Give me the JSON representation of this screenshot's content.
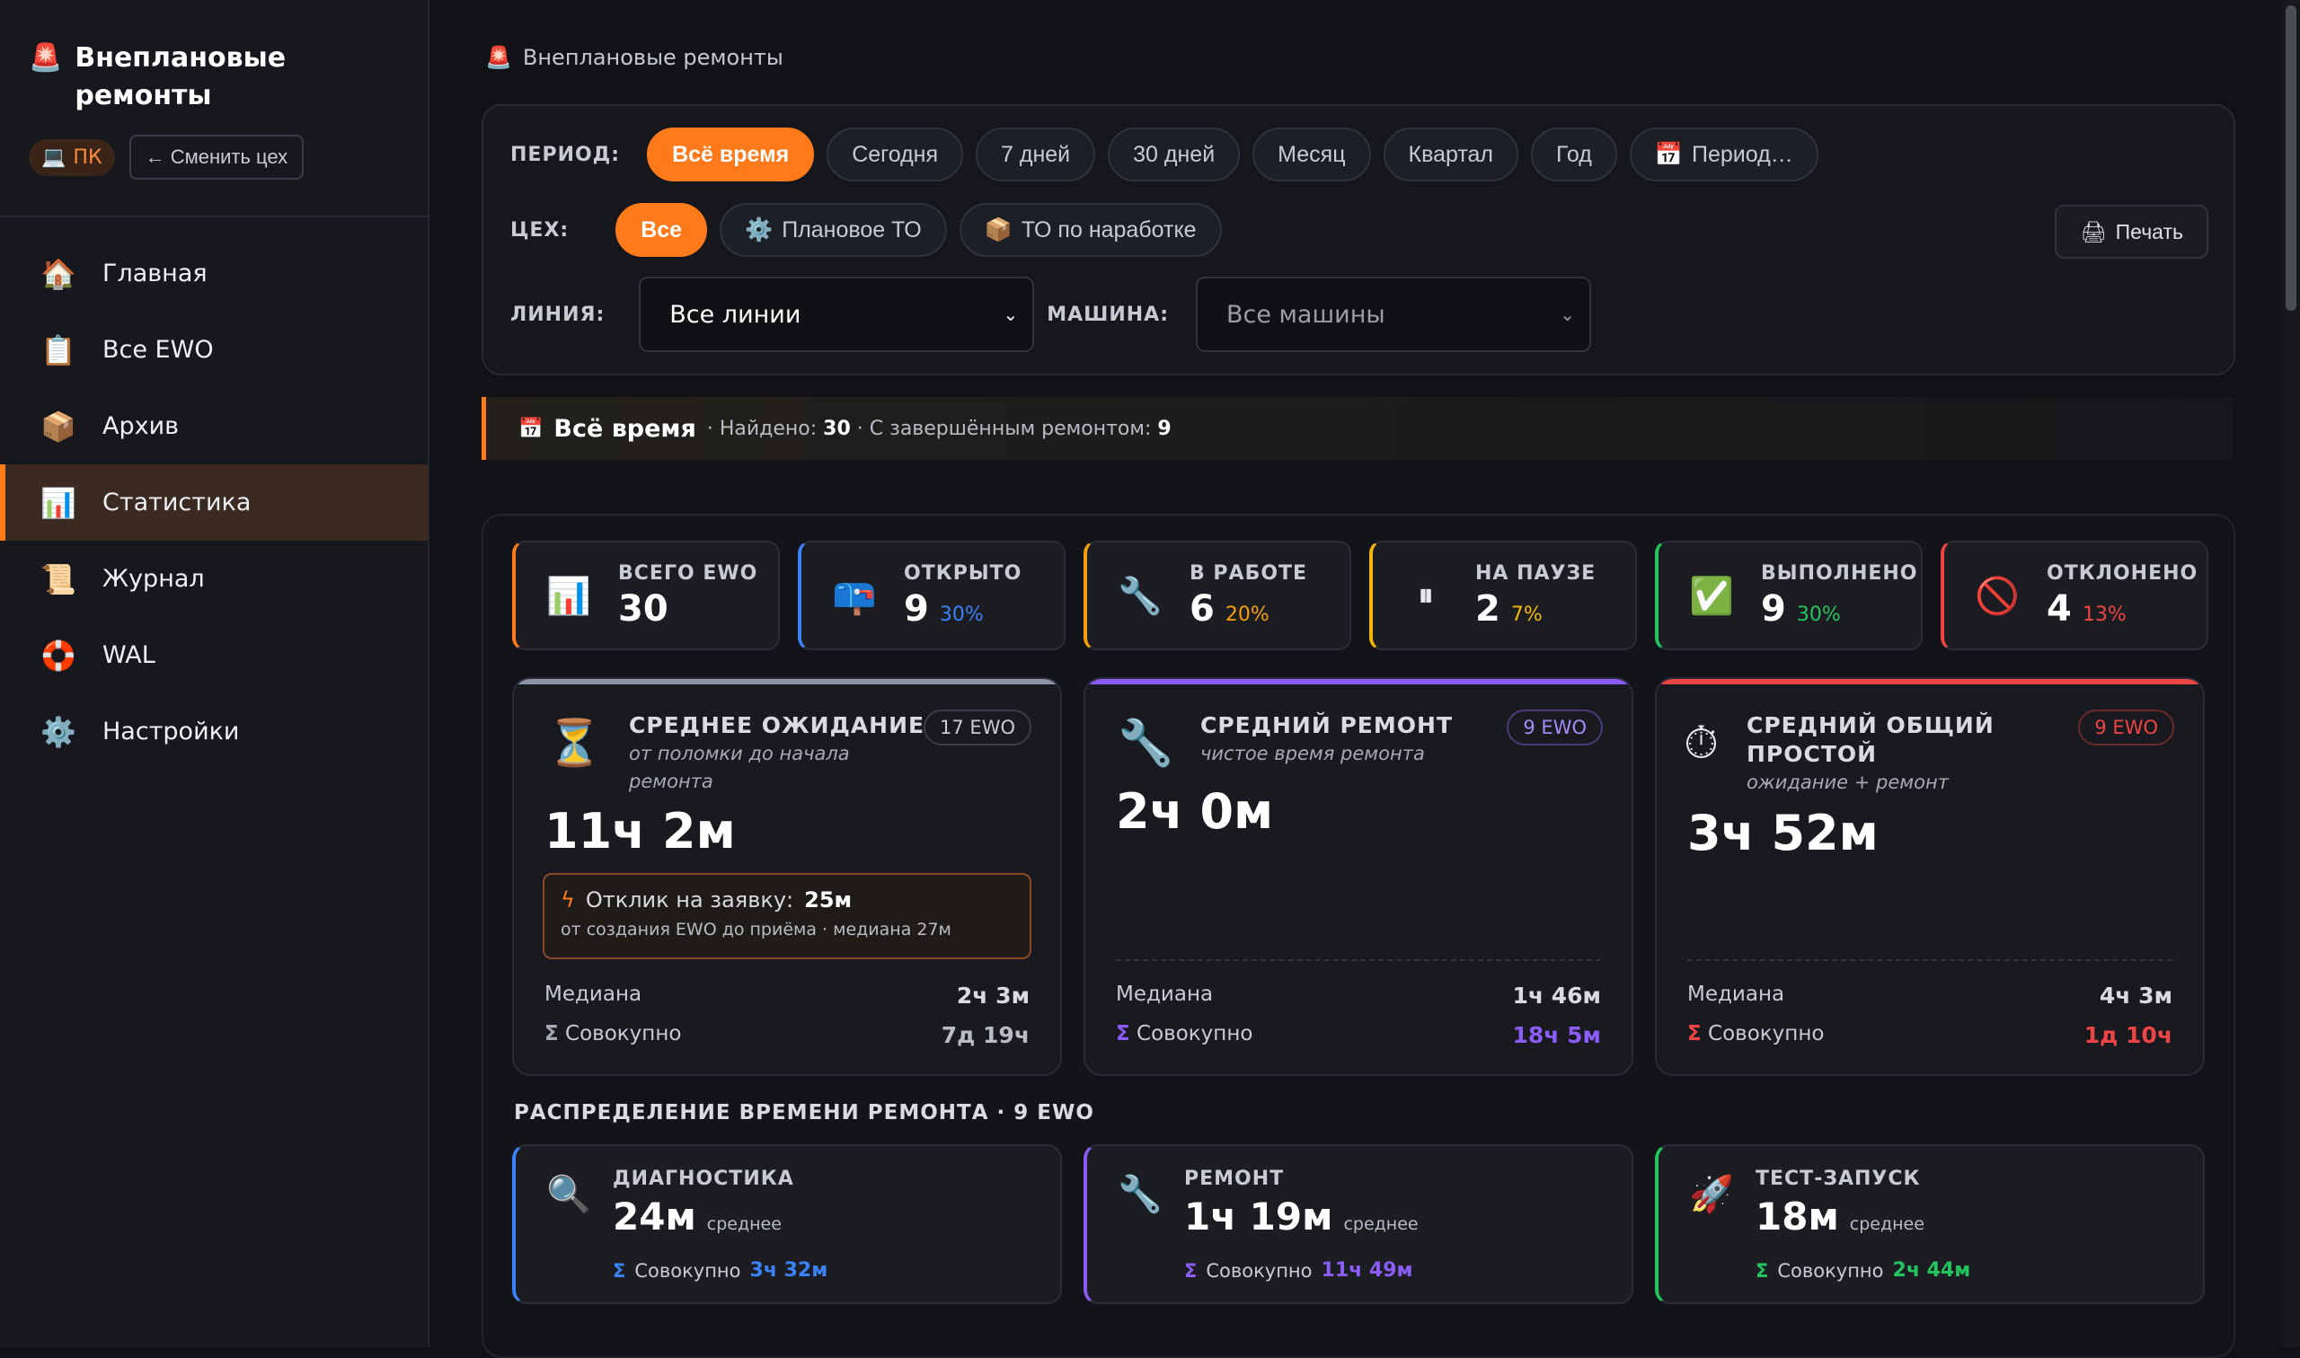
{
  "brand": {
    "title": "Внеплановые ремонты",
    "badge": "ПК",
    "switch_label": "← Сменить цех"
  },
  "nav": [
    {
      "label": "Главная",
      "icon": "home-icon"
    },
    {
      "label": "Все EWO",
      "icon": "clipboard-icon"
    },
    {
      "label": "Архив",
      "icon": "box-icon"
    },
    {
      "label": "Статистика",
      "icon": "chart-icon"
    },
    {
      "label": "Журнал",
      "icon": "scroll-icon"
    },
    {
      "label": "WAL",
      "icon": "lifebuoy-icon"
    },
    {
      "label": "Настройки",
      "icon": "gear-icon"
    }
  ],
  "crumb": "Внеплановые ремонты",
  "filters": {
    "period_label": "ПЕРИОД:",
    "periods": [
      "Всё время",
      "Сегодня",
      "7 дней",
      "30 дней",
      "Месяц",
      "Квартал",
      "Год",
      "Период…"
    ],
    "shop_label": "ЦЕХ:",
    "shops": [
      "Все",
      "Плановое ТО",
      "ТО по наработке"
    ],
    "line_label": "ЛИНИЯ:",
    "line_value": "Все линии",
    "machine_label": "МАШИНА:",
    "machine_value": "Все машины",
    "print_label": "Печать"
  },
  "summary": {
    "period": "Всё время",
    "found_label": "· Найдено:",
    "found": "30",
    "completed_label": "· С завершённым ремонтом:",
    "completed": "9"
  },
  "stats": [
    {
      "label": "ВСЕГО EWO",
      "value": "30",
      "pct": "",
      "color": "#ff7a1a"
    },
    {
      "label": "ОТКРЫТО",
      "value": "9",
      "pct": "30%",
      "color": "#3b82f6"
    },
    {
      "label": "В РАБОТЕ",
      "value": "6",
      "pct": "20%",
      "color": "#f59e0b"
    },
    {
      "label": "НА ПАУЗЕ",
      "value": "2",
      "pct": "7%",
      "color": "#f5b60b"
    },
    {
      "label": "ВЫПОЛНЕНО",
      "value": "9",
      "pct": "30%",
      "color": "#22c55e"
    },
    {
      "label": "ОТКЛОНЕНО",
      "value": "4",
      "pct": "13%",
      "color": "#ef4444"
    }
  ],
  "cards": {
    "wait": {
      "title": "СРЕДНЕЕ ОЖИДАНИЕ",
      "subtitle": "от поломки до начала ремонта",
      "badge": "17 EWO",
      "value": "11ч 2м",
      "response_label": "Отклик на заявку:",
      "response_value": "25м",
      "response_sub": "от создания EWO до приёма · медиана 27м",
      "median_label": "Медиана",
      "median": "2ч 3м",
      "total_label": "Совокупно",
      "total": "7д 19ч"
    },
    "repair": {
      "title": "СРЕДНИЙ РЕМОНТ",
      "subtitle": "чистое время ремонта",
      "badge": "9 EWO",
      "value": "2ч 0м",
      "median_label": "Медиана",
      "median": "1ч 46м",
      "total_label": "Совокупно",
      "total": "18ч 5м"
    },
    "downtime": {
      "title": "СРЕДНИЙ ОБЩИЙ ПРОСТОЙ",
      "subtitle": "ожидание + ремонт",
      "badge": "9 EWO",
      "value": "3ч 52м",
      "median_label": "Медиана",
      "median": "4ч 3м",
      "total_label": "Совокупно",
      "total": "1д 10ч"
    }
  },
  "distribution": {
    "title": "РАСПРЕДЕЛЕНИЕ ВРЕМЕНИ РЕМОНТА · 9 EWO",
    "avg_label": "среднее",
    "total_label": "Совокупно",
    "items": [
      {
        "label": "ДИАГНОСТИКА",
        "value": "24м",
        "total": "3ч 32м",
        "color": "#3b82f6"
      },
      {
        "label": "РЕМОНТ",
        "value": "1ч 19м",
        "total": "11ч 49м",
        "color": "#8b5cf6"
      },
      {
        "label": "ТЕСТ-ЗАПУСК",
        "value": "18м",
        "total": "2ч 44м",
        "color": "#22c55e"
      }
    ]
  }
}
